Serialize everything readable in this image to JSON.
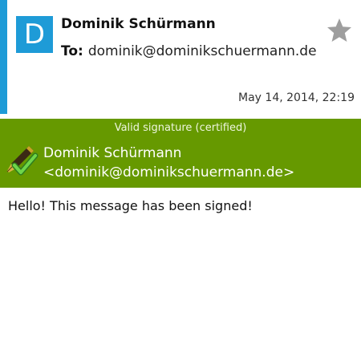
{
  "header": {
    "avatar_letter": "D",
    "sender_name": "Dominik Schürmann",
    "to_label": "To:",
    "to_address": "dominik@dominikschuermann.de",
    "date": "May 14, 2014, 22:19",
    "star_icon": "star-icon"
  },
  "signature": {
    "status": "Valid signature (certified)",
    "icon": "signature-valid-icon",
    "name": "Dominik Schürmann",
    "email": "<dominik@dominikschuermann.de>"
  },
  "message": {
    "body": "Hello! This message has been signed!"
  },
  "colors": {
    "accent_blue": "#1e9bd7",
    "signature_green": "#669900",
    "star_gray": "#9e9e9e"
  }
}
